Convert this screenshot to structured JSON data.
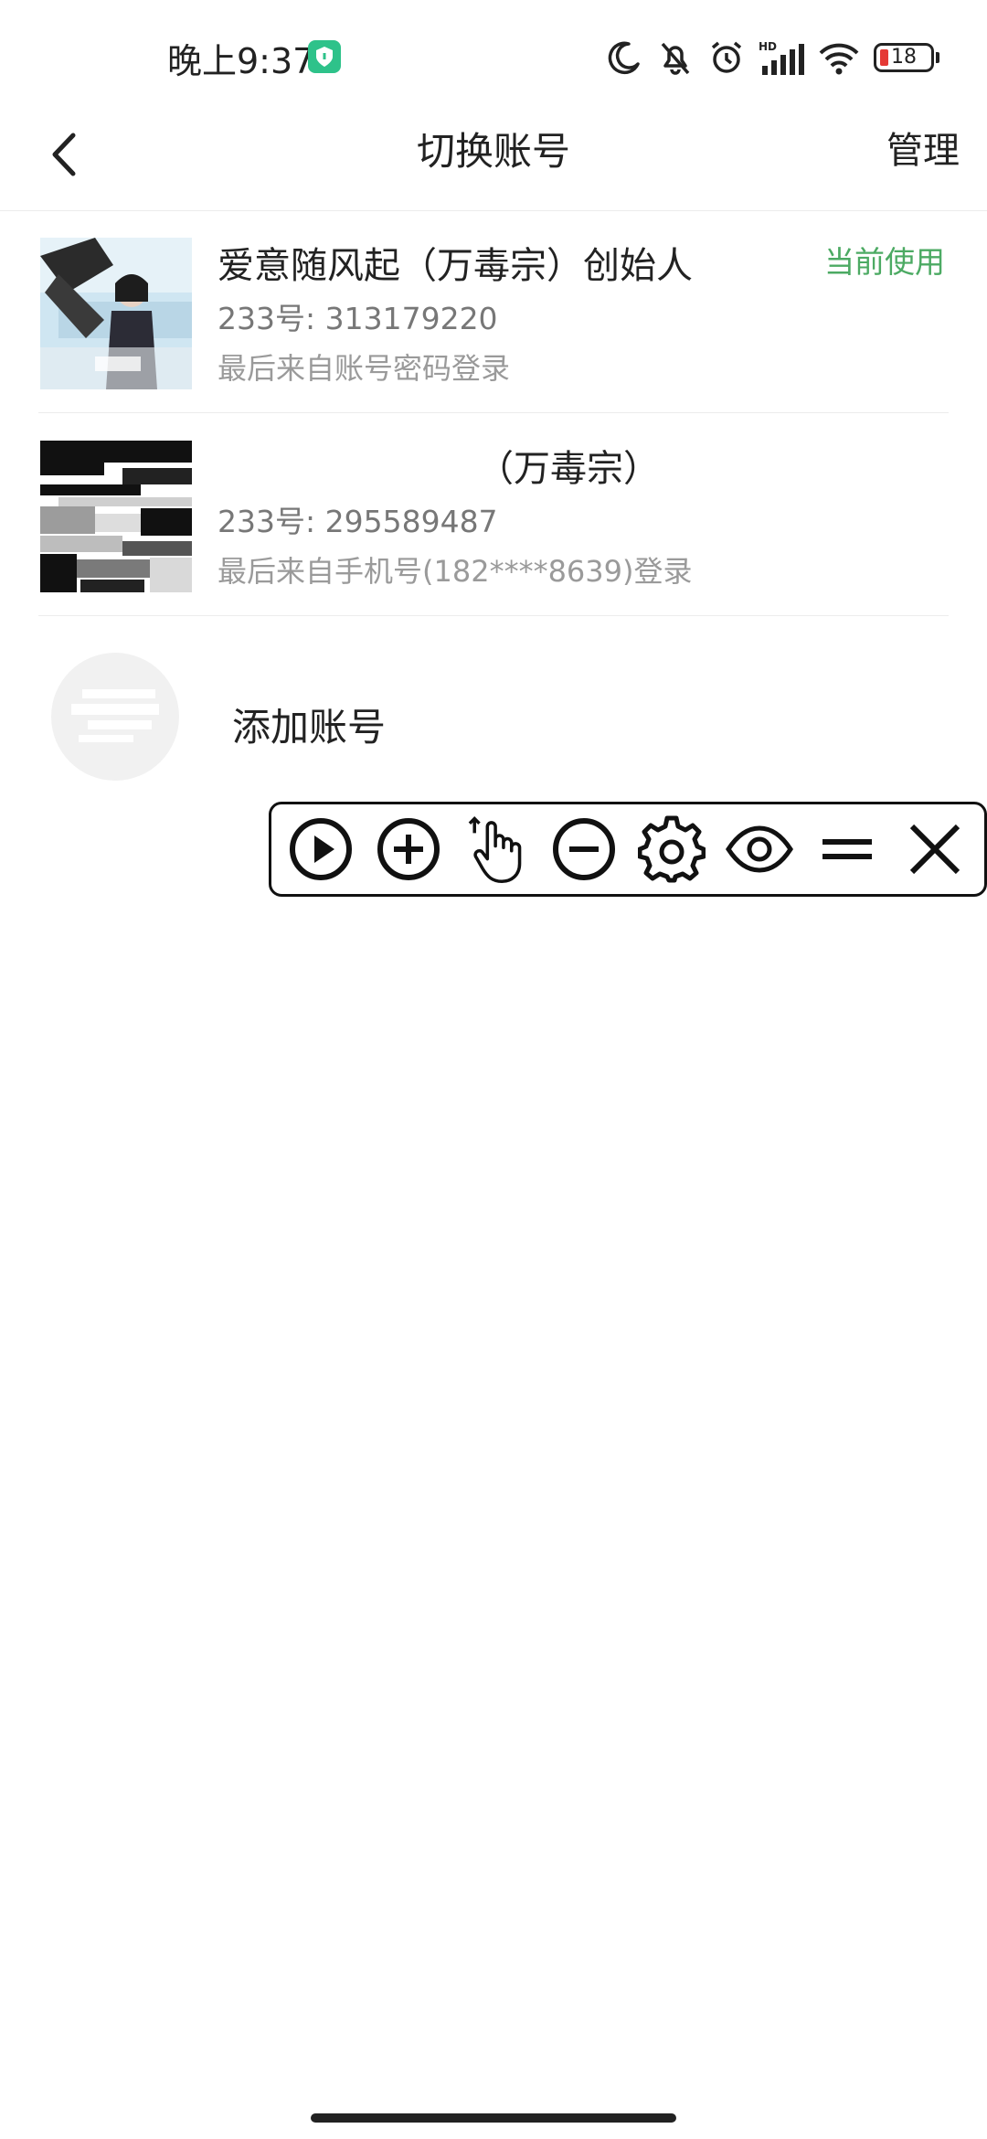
{
  "status_bar": {
    "time": "晚上9:37",
    "battery_level": "18",
    "icons": [
      "shield-icon",
      "moon-icon",
      "bell-muted-icon",
      "alarm-icon",
      "signal-icon",
      "wifi-icon",
      "battery-icon"
    ],
    "shield_color": "#2ec28a",
    "battery_low_color": "#e53935"
  },
  "nav": {
    "title": "切换账号",
    "manage_label": "管理"
  },
  "accounts": [
    {
      "name": "爱意随风起（万毒宗）创始人",
      "uid": "233号: 313179220",
      "source": "最后来自账号密码登录",
      "status": "当前使用"
    },
    {
      "name": "（万毒宗）",
      "uid": "233号: 295589487",
      "source": "最后来自手机号(182****8639)登录"
    }
  ],
  "add_account": {
    "label": "添加账号"
  },
  "floating_toolbar": {
    "buttons": [
      "play-icon",
      "plus-circle-icon",
      "tap-hand-icon",
      "minus-circle-icon",
      "gear-icon",
      "eye-icon",
      "equals-icon",
      "close-icon"
    ]
  },
  "colors": {
    "accent_green": "#4caa63",
    "text_primary": "#222222",
    "text_secondary": "#777777"
  }
}
